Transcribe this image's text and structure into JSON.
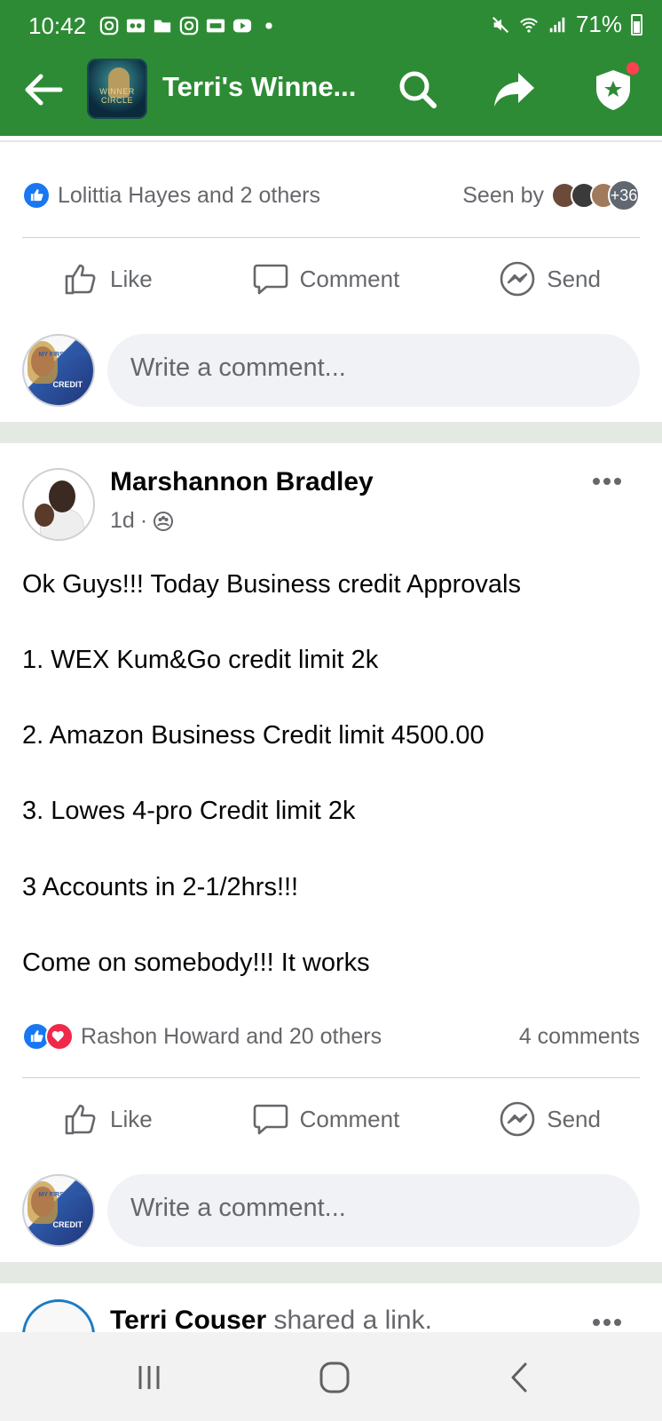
{
  "status_bar": {
    "time": "10:42",
    "battery": "71%",
    "battery_level": 0.71
  },
  "header": {
    "title": "Terri's Winne...",
    "group_avatar_text": "WINNER CIRCLE",
    "bg_color": "#2e8b35",
    "icons": [
      "back-arrow-icon",
      "search-icon",
      "share-icon",
      "shield-star-icon"
    ]
  },
  "prev_post": {
    "reactions_text": "Lolittia Hayes and 2 others",
    "seen_by_label": "Seen by",
    "seen_more": "+36",
    "comment_placeholder": "Write a comment..."
  },
  "actions": {
    "like": "Like",
    "comment": "Comment",
    "send": "Send"
  },
  "commenter_avatar": {
    "top_text": "MY FIRST HOME",
    "bottom_text": "CREDIT"
  },
  "post": {
    "author": "Marshannon Bradley",
    "time": "1d",
    "separator": "·",
    "lines": [
      "Ok Guys!!! Today Business credit Approvals",
      "1. WEX Kum&Go credit limit 2k",
      "2. Amazon Business Credit limit 4500.00",
      "3. Lowes 4-pro Credit limit 2k",
      "3 Accounts in 2-1/2hrs!!!",
      "Come on somebody!!! It works"
    ],
    "reactions_text": "Rashon Howard and 20 others",
    "comments_count": "4 comments",
    "comment_placeholder": "Write a comment..."
  },
  "next_post": {
    "author": "Terri Couser",
    "action": "shared a link."
  },
  "colors": {
    "brand_green": "#2e8b35",
    "like_blue": "#1877f2",
    "love_red": "#f0284a",
    "muted_text": "#65676b"
  }
}
